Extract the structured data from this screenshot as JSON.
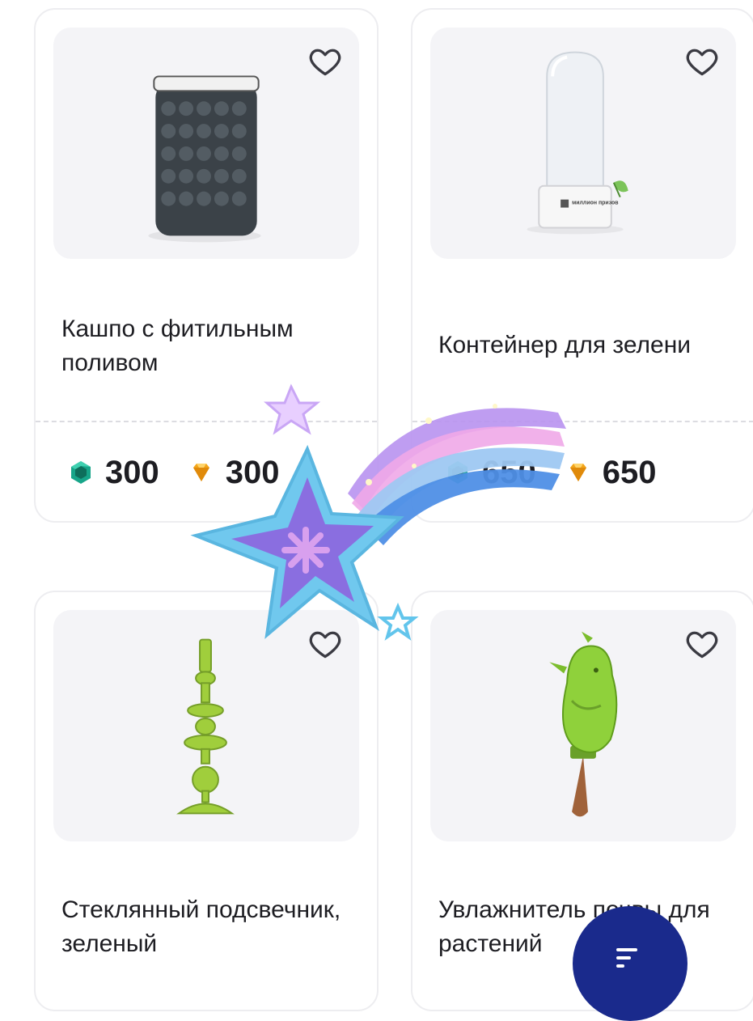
{
  "products": [
    {
      "title": "Кашпо с фитильным поливом",
      "price_emerald": "300",
      "price_gold": "300"
    },
    {
      "title": "Контейнер для зелени",
      "price_emerald": "650",
      "price_gold": "650"
    },
    {
      "title": "Стеклянный подсвечник, зеленый"
    },
    {
      "title": "Увлажнитель почвы для растений"
    }
  ],
  "container_brand": "миллион призов",
  "icons": {
    "favorite": "heart-outline-icon",
    "currency_1": "emerald-gem-icon",
    "currency_2": "gold-diamond-icon",
    "fab": "filter-icon"
  },
  "colors": {
    "card_border": "#ededf0",
    "image_bg": "#f4f4f7",
    "fab": "#1a2a8c",
    "emerald": "#17a589",
    "gold": "#f3a51a"
  }
}
